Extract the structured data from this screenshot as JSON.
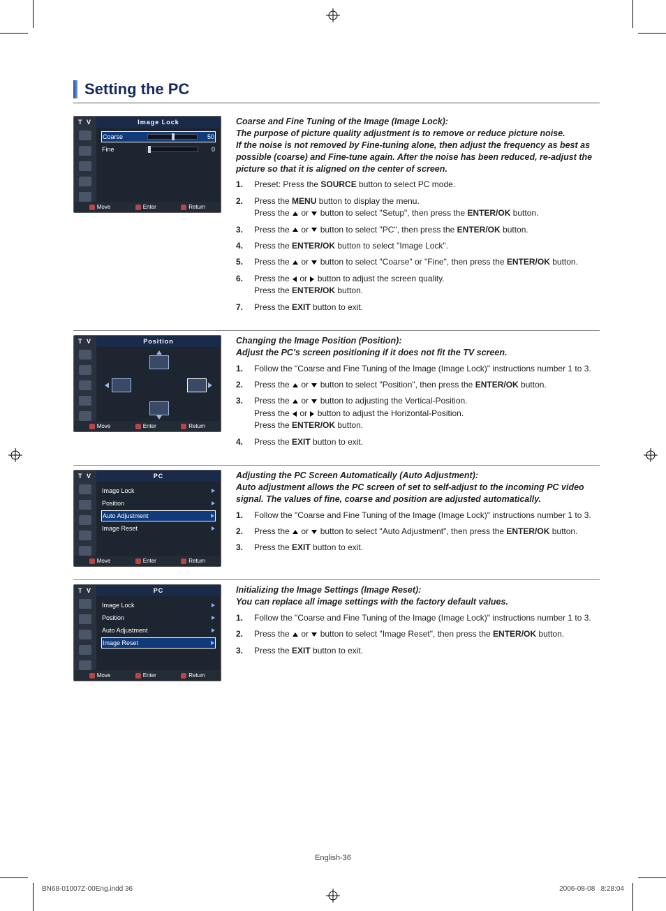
{
  "page": {
    "title": "Setting the PC",
    "number_label": "English-36",
    "footer_left": "BN68-01007Z-00Eng.indd   36",
    "footer_date": "2006-08-08",
    "footer_time": "8:28:04"
  },
  "osd_common": {
    "tv": "T V",
    "footer_move": "Move",
    "footer_enter": "Enter",
    "footer_return": "Return"
  },
  "osd_imagelock": {
    "title": "Image Lock",
    "rows": [
      {
        "label": "Coarse",
        "value": "50",
        "knob_pct": 48,
        "selected": true
      },
      {
        "label": "Fine",
        "value": "0",
        "knob_pct": 2,
        "selected": false
      }
    ]
  },
  "osd_position": {
    "title": "Position"
  },
  "osd_pc_auto": {
    "title": "PC",
    "items": [
      {
        "label": "Image Lock",
        "selected": false
      },
      {
        "label": "Position",
        "selected": false
      },
      {
        "label": "Auto Adjustment",
        "selected": true
      },
      {
        "label": "Image Reset",
        "selected": false
      }
    ]
  },
  "osd_pc_reset": {
    "title": "PC",
    "items": [
      {
        "label": "Image Lock",
        "selected": false
      },
      {
        "label": "Position",
        "selected": false
      },
      {
        "label": "Auto Adjustment",
        "selected": false
      },
      {
        "label": "Image Reset",
        "selected": true
      }
    ]
  },
  "section1": {
    "head1": "Coarse and Fine Tuning of the Image (Image Lock):",
    "head2": "The purpose of picture quality adjustment is to remove or reduce picture noise.",
    "head3": "If the noise is not removed by Fine-tuning alone, then adjust the frequency as best as possible (coarse) and Fine-tune again. After the noise has been reduced, re-adjust the picture so that it is aligned on the center of screen.",
    "steps": {
      "s1a": "Preset: Press the ",
      "s1b": "SOURCE",
      "s1c": " button to select PC mode.",
      "s2a": "Press the ",
      "s2b": "MENU",
      "s2c": " button to display the menu.",
      "s2d": "Press the ",
      "s2e": " or ",
      "s2f": " button to select \"Setup\", then press the ",
      "s2g": "ENTER/OK",
      "s2h": " button.",
      "s3a": "Press the ",
      "s3b": " or ",
      "s3c": " button to select \"PC\", then press the ",
      "s3d": "ENTER/OK",
      "s3e": " button.",
      "s4a": "Press the ",
      "s4b": "ENTER/OK",
      "s4c": " button to select \"Image Lock\".",
      "s5a": "Press the ",
      "s5b": " or ",
      "s5c": " button to select \"Coarse\" or \"Fine\", then press the ",
      "s5d": "ENTER/OK",
      "s5e": " button.",
      "s6a": "Press the ",
      "s6b": " or ",
      "s6c": " button to adjust the screen quality.",
      "s6d": "Press the ",
      "s6e": "ENTER/OK",
      "s6f": " button.",
      "s7a": "Press the ",
      "s7b": "EXIT",
      "s7c": " button to exit."
    }
  },
  "section2": {
    "head1": "Changing the Image Position (Position):",
    "head2": "Adjust the PC's screen positioning if it does not fit the TV screen.",
    "steps": {
      "s1": "Follow the \"Coarse and Fine Tuning of the Image (Image Lock)\" instructions number 1 to 3.",
      "s2a": "Press the ",
      "s2b": " or ",
      "s2c": " button to select \"Position\", then press the ",
      "s2d": "ENTER/OK",
      "s2e": " button.",
      "s3a": "Press the ",
      "s3b": " or ",
      "s3c": " button to adjusting the Vertical-Position.",
      "s3d": "Press the ",
      "s3e": " or ",
      "s3f": " button to adjust the Horizontal-Position.",
      "s3g": "Press the ",
      "s3h": "ENTER/OK",
      "s3i": " button.",
      "s4a": "Press the ",
      "s4b": "EXIT",
      "s4c": " button to exit."
    }
  },
  "section3": {
    "head1": "Adjusting the PC Screen Automatically (Auto Adjustment):",
    "head2": "Auto adjustment allows the PC screen of set to self-adjust to the incoming PC video signal. The values of fine, coarse and position are adjusted automatically.",
    "steps": {
      "s1": "Follow the \"Coarse and Fine Tuning of the Image (Image Lock)\" instructions number 1 to 3.",
      "s2a": "Press the ",
      "s2b": " or ",
      "s2c": " button to select \"Auto Adjustment\", then press the ",
      "s2d": "ENTER/OK",
      "s2e": " button.",
      "s3a": "Press the ",
      "s3b": "EXIT",
      "s3c": " button to exit."
    }
  },
  "section4": {
    "head1": "Initializing the Image Settings (Image Reset):",
    "head2": "You can replace all image settings with the factory default values.",
    "steps": {
      "s1": "Follow the \"Coarse and Fine Tuning of the Image (Image Lock)\" instructions number 1 to 3.",
      "s2a": "Press the ",
      "s2b": " or ",
      "s2c": " button to select \"Image Reset\", then press the ",
      "s2d": "ENTER/OK",
      "s2e": " button.",
      "s3a": "Press the ",
      "s3b": "EXIT",
      "s3c": " button to exit."
    }
  }
}
